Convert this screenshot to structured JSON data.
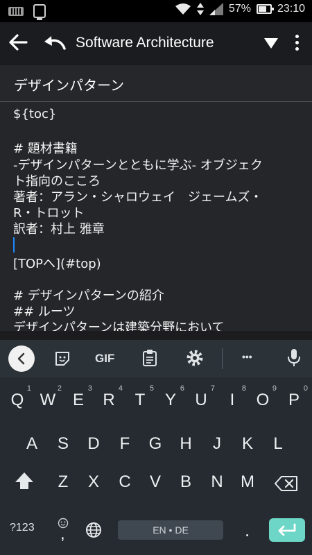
{
  "status_bar": {
    "battery_percent": "57%",
    "time": "23:10"
  },
  "app_bar": {
    "title": "Software Architecture"
  },
  "document": {
    "title": "デザインパターン",
    "lines": [
      "${toc}",
      "",
      "# 題材書籍",
      "-デザインパターンとともに学ぶ- オブジェク",
      "ト指向のこころ",
      "著者：アラン・シャロウェイ　ジェームズ・",
      "R・トロット",
      "訳者：村上 雅章",
      "",
      "[TOPへ](#top)",
      "",
      "# デザインパターンの紹介",
      "## ルーツ",
      "デザインパターンは建築分野において"
    ]
  },
  "keyboard": {
    "toolbar": {
      "gif_label": "GIF",
      "more_label": "•••"
    },
    "row1": [
      {
        "label": "Q",
        "hint": "1"
      },
      {
        "label": "W",
        "hint": "2"
      },
      {
        "label": "E",
        "hint": "3"
      },
      {
        "label": "R",
        "hint": "4"
      },
      {
        "label": "T",
        "hint": "5"
      },
      {
        "label": "Y",
        "hint": "6"
      },
      {
        "label": "U",
        "hint": "7"
      },
      {
        "label": "I",
        "hint": "8"
      },
      {
        "label": "O",
        "hint": "9"
      },
      {
        "label": "P",
        "hint": "0"
      }
    ],
    "row2": [
      "A",
      "S",
      "D",
      "F",
      "G",
      "H",
      "J",
      "K",
      "L"
    ],
    "row3": [
      "Z",
      "X",
      "C",
      "V",
      "B",
      "N",
      "M"
    ],
    "bottom": {
      "symbols_label": "?123",
      "comma_label": ",",
      "space_label": "EN • DE",
      "period_label": "."
    }
  }
}
